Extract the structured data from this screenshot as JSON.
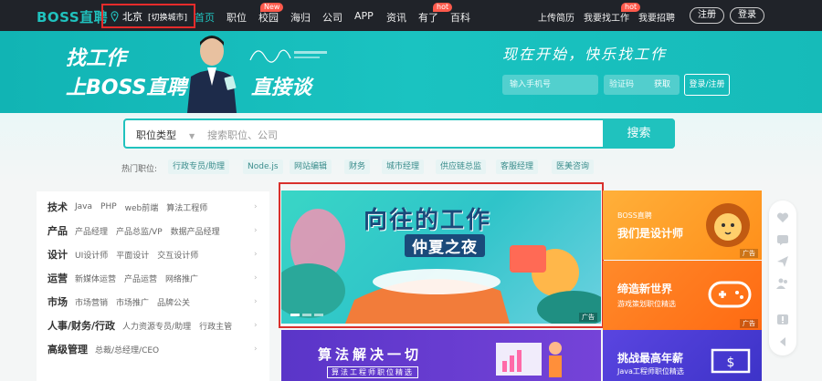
{
  "topbar": {
    "logo": "BOSS直聘",
    "city": "北京",
    "city_switch": "[切换城市]",
    "nav": [
      {
        "label": "首页"
      },
      {
        "label": "职位"
      },
      {
        "label": "校园"
      },
      {
        "label": "海归"
      },
      {
        "label": "公司"
      },
      {
        "label": "APP"
      },
      {
        "label": "资讯"
      },
      {
        "label": "有了"
      },
      {
        "label": "百科"
      }
    ],
    "badge_new": "New",
    "badge_hot": "hot",
    "upload_resume": "上传简历",
    "find_job": "我要找工作",
    "find_job_badge": "hot",
    "recruit": "我要招聘",
    "register": "注册",
    "login": "登录"
  },
  "banner": {
    "line1": "找工作",
    "line2": "上BOSS直聘",
    "line3": "直接谈",
    "slogan": "现在开始，快乐找工作",
    "phone_placeholder": "输入手机号",
    "code_placeholder": "验证码",
    "get_code": "获取",
    "login_register": "登录/注册"
  },
  "search": {
    "type_label": "职位类型",
    "placeholder": "搜索职位、公司",
    "button": "搜索",
    "hot_label": "热门职位:",
    "hot_tags": [
      "行政专员/助理",
      "Node.js",
      "网站编辑",
      "财务",
      "城市经理",
      "供应链总监",
      "客服经理",
      "医美咨询"
    ]
  },
  "categories": [
    {
      "title": "技术",
      "items": [
        "Java",
        "PHP",
        "web前端",
        "算法工程师"
      ]
    },
    {
      "title": "产品",
      "items": [
        "产品经理",
        "产品总监/VP",
        "数据产品经理"
      ]
    },
    {
      "title": "设计",
      "items": [
        "UI设计师",
        "平面设计",
        "交互设计师"
      ]
    },
    {
      "title": "运营",
      "items": [
        "新媒体运营",
        "产品运营",
        "网络推广"
      ]
    },
    {
      "title": "市场",
      "items": [
        "市场营销",
        "市场推广",
        "品牌公关"
      ]
    },
    {
      "title": "人事/财务/行政",
      "items": [
        "人力资源专员/助理",
        "行政主管"
      ]
    },
    {
      "title": "高级管理",
      "items": [
        "总裁/总经理/CEO"
      ]
    }
  ],
  "promo": {
    "title": "向往的工作",
    "subtitle": "仲夏之夜",
    "ad": "广告"
  },
  "algo": {
    "title": "算法解决一切",
    "subtitle": "算法工程师职位精选"
  },
  "cards": [
    {
      "t1": "BOSS直聘",
      "t2": "我们是设计师",
      "t3": "",
      "color": "#ff9a1f"
    },
    {
      "t1": "",
      "t2": "缔造新世界",
      "t3": "游戏策划职位精选",
      "color": "#ff7d1a"
    },
    {
      "t1": "",
      "t2": "挑战最高年薪",
      "t3": "Java工程师职位精选",
      "color": "#4b3fd1"
    }
  ],
  "card_ad": "广告",
  "colors": {
    "brand": "#20c2be",
    "dark": "#202329",
    "highlight_box": "#e52b2b"
  }
}
